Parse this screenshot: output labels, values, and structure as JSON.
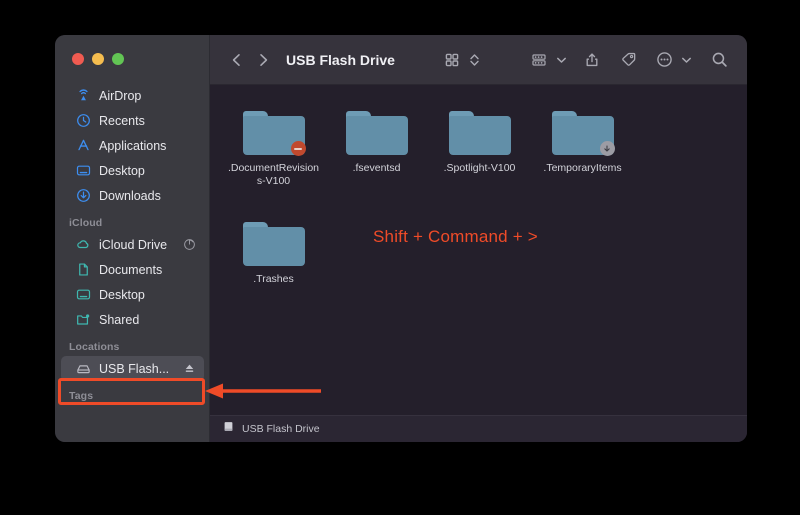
{
  "window": {
    "title": "USB Flash Drive",
    "traffic_lights": [
      "close",
      "minimize",
      "zoom"
    ]
  },
  "toolbar": {
    "back_icon": "chevron-left-icon",
    "forward_icon": "chevron-right-icon",
    "title": "USB Flash Drive",
    "view_icon": "grid-view-icon",
    "view_stepper_icon": "chevron-updown-icon",
    "group_icon": "group-by-icon",
    "group_chevron_icon": "chevron-down-icon",
    "share_icon": "share-icon",
    "tag_icon": "tag-icon",
    "more_icon": "ellipsis-circle-icon",
    "more_chevron_icon": "chevron-down-icon",
    "search_icon": "search-icon"
  },
  "sidebar": {
    "favorites": [
      {
        "label": "AirDrop",
        "icon": "airdrop-icon",
        "selected": false
      },
      {
        "label": "Recents",
        "icon": "clock-icon",
        "selected": false
      },
      {
        "label": "Applications",
        "icon": "applications-icon",
        "selected": false
      },
      {
        "label": "Desktop",
        "icon": "desktop-icon",
        "selected": false
      },
      {
        "label": "Downloads",
        "icon": "download-icon",
        "selected": false
      }
    ],
    "icloud_header": "iCloud",
    "icloud": [
      {
        "label": "iCloud Drive",
        "icon": "cloud-icon",
        "trailing": "sync-progress-icon",
        "selected": false
      },
      {
        "label": "Documents",
        "icon": "document-icon",
        "trailing": "",
        "selected": false
      },
      {
        "label": "Desktop",
        "icon": "desktop-icon",
        "trailing": "",
        "selected": false
      },
      {
        "label": "Shared",
        "icon": "shared-folder-icon",
        "trailing": "",
        "selected": false
      }
    ],
    "locations_header": "Locations",
    "locations": [
      {
        "label": "USB Flash...",
        "icon": "drive-icon",
        "trailing": "eject-icon",
        "selected": true
      }
    ],
    "tags_header": "Tags"
  },
  "files": {
    "row1": [
      {
        "name": ".DocumentRevisions-V100",
        "icon": "folder-icon",
        "badge": "stop-badge"
      },
      {
        "name": ".fseventsd",
        "icon": "folder-icon",
        "badge": ""
      },
      {
        "name": ".Spotlight-V100",
        "icon": "folder-icon",
        "badge": ""
      },
      {
        "name": ".TemporaryItems",
        "icon": "folder-icon",
        "badge": "download-badge"
      }
    ],
    "row2": [
      {
        "name": ".Trashes",
        "icon": "folder-icon",
        "badge": ""
      }
    ]
  },
  "annotations": {
    "shortcut_text": "Shift + Command + >",
    "accent_color": "#ef4b28",
    "highlight_target": "USB Flash...",
    "arrow_direction": "left"
  },
  "pathbar": {
    "icon": "drive-icon",
    "label": "USB Flash Drive"
  },
  "colors": {
    "sidebar_bg": "#3a3a40",
    "content_bg": "#241f2b",
    "toolbar_bg": "#36333c",
    "folder_blue": "#628fa8",
    "annotation_red": "#ef4b28",
    "selected_row": "#4d4d55"
  }
}
